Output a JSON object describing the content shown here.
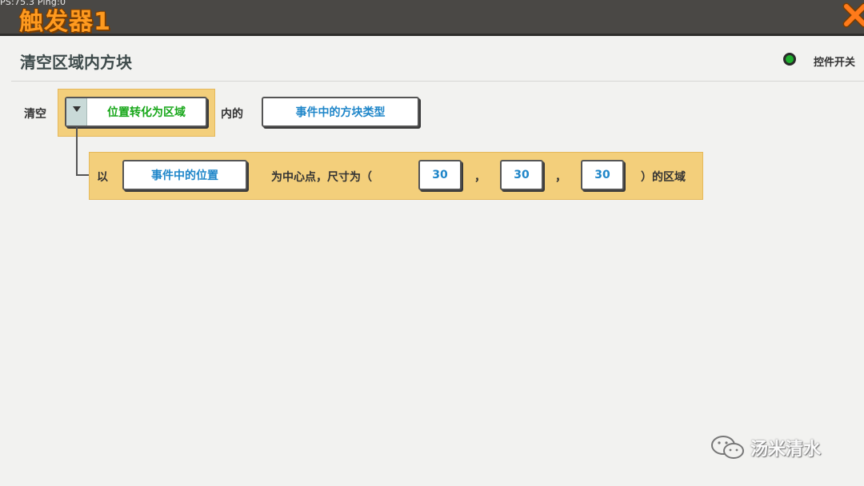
{
  "topbar": {
    "fps_text": "PS:75.3  Ping:0",
    "title": "触发器1"
  },
  "header": {
    "title": "清空区域内方块",
    "toggle_label": "控件开关",
    "toggle_color": "#1fae2e"
  },
  "rule": {
    "clear_label": "清空",
    "dropdown_value": "位置转化为区域",
    "inner_label": "内的",
    "block_type_button": "事件中的方块类型"
  },
  "subrule": {
    "with_label": "以",
    "position_button": "事件中的位置",
    "center_text": "为中心点，尺寸为（",
    "size_x": "30",
    "comma1": "，",
    "size_y": "30",
    "comma2": "，",
    "size_z": "30",
    "end_text": "）的区域"
  },
  "watermark": {
    "text": "汤米清水"
  },
  "colors": {
    "accent_orange": "#ff9a1f",
    "block_bg": "#f3cf7b",
    "value_blue": "#1f86c9",
    "value_green": "#18a71a"
  }
}
